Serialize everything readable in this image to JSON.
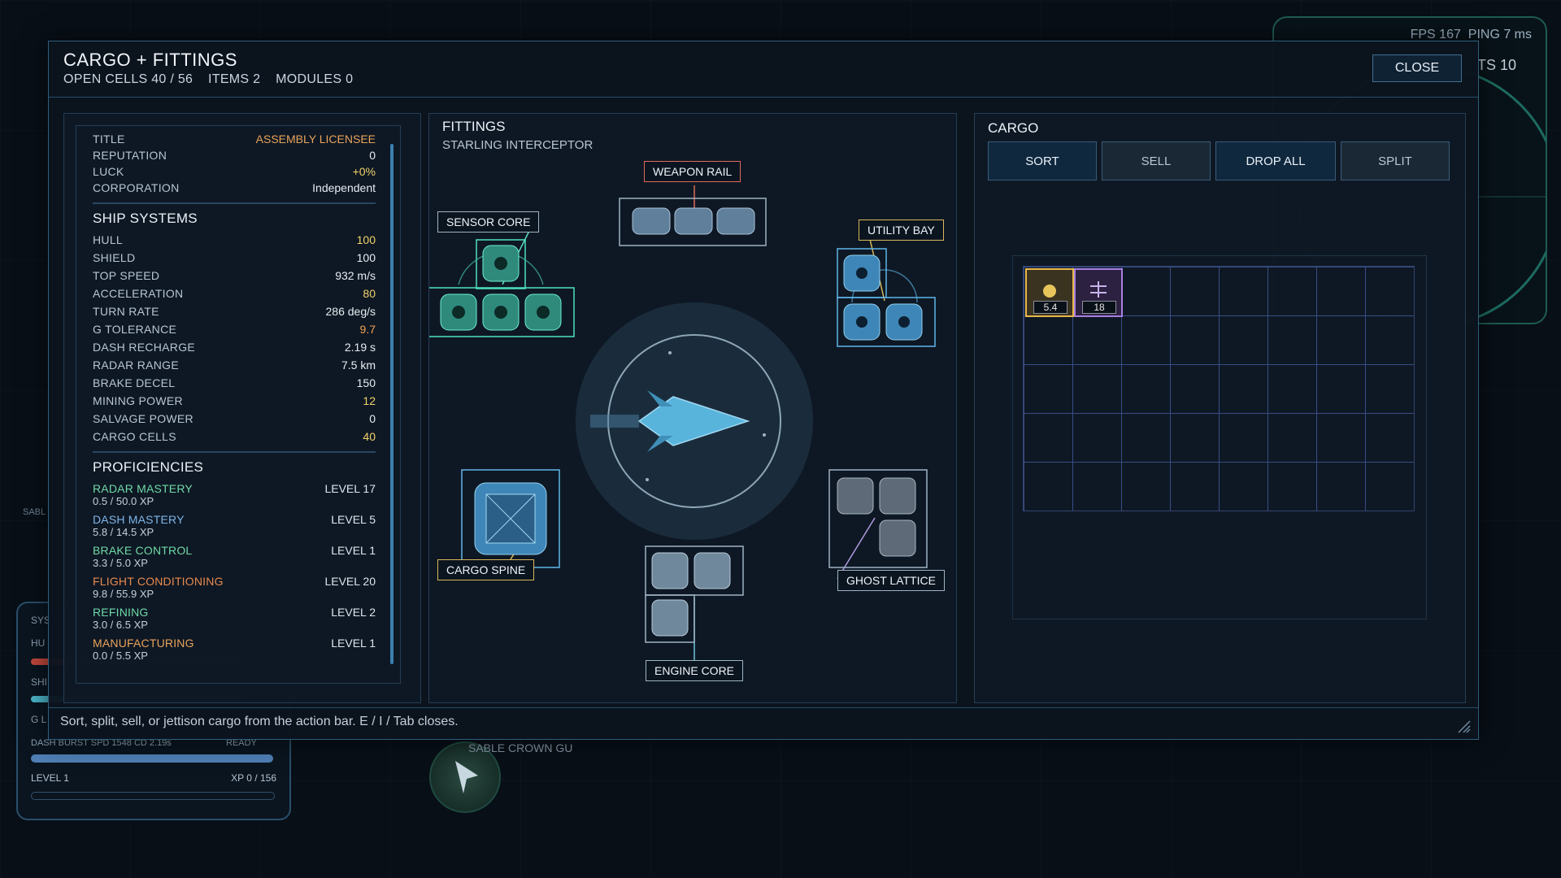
{
  "hud": {
    "fps_text": "FPS 167",
    "ping_text": "PING 7 ms",
    "side_value": "TS 10",
    "bottom_left": {
      "labels": [
        "SYS",
        "HU",
        "SHI",
        "G L"
      ],
      "dash_text": "DASH BURST  SPD 1548  CD 2.19s",
      "dash_ready": "READY",
      "level_label": "LEVEL 1",
      "xp_text": "XP 0 / 156",
      "sable": "SABL"
    },
    "nearby_name": "SABLE CROWN GU"
  },
  "panel": {
    "title": "CARGO + FITTINGS",
    "open_cells": "OPEN CELLS 40 / 56",
    "items": "ITEMS 2",
    "modules": "MODULES 0",
    "close_label": "CLOSE",
    "footer_hint": "Sort, split, sell, or jettison cargo from the action bar. E / I / Tab closes."
  },
  "profile": [
    {
      "key": "TITLE",
      "value": "ASSEMBLY LICENSEE",
      "color": "#e9a35a"
    },
    {
      "key": "REPUTATION",
      "value": "0",
      "color": "#e6edf3"
    },
    {
      "key": "LUCK",
      "value": "+0%",
      "color": "#f2d36b"
    },
    {
      "key": "CORPORATION",
      "value": "Independent",
      "color": "#e6edf3"
    }
  ],
  "ship_systems": {
    "heading": "SHIP SYSTEMS",
    "rows": [
      {
        "key": "HULL",
        "value": "100",
        "color": "#f2d36b"
      },
      {
        "key": "SHIELD",
        "value": "100",
        "color": "#e6edf3"
      },
      {
        "key": "TOP SPEED",
        "value": "932 m/s",
        "color": "#e6edf3"
      },
      {
        "key": "ACCELERATION",
        "value": "80",
        "color": "#f2d36b"
      },
      {
        "key": "TURN RATE",
        "value": "286 deg/s",
        "color": "#e6edf3"
      },
      {
        "key": "G TOLERANCE",
        "value": "9.7",
        "color": "#f0a050"
      },
      {
        "key": "DASH RECHARGE",
        "value": "2.19 s",
        "color": "#e6edf3"
      },
      {
        "key": "RADAR RANGE",
        "value": "7.5 km",
        "color": "#e6edf3"
      },
      {
        "key": "BRAKE DECEL",
        "value": "150",
        "color": "#e6edf3"
      },
      {
        "key": "MINING POWER",
        "value": "12",
        "color": "#f2d36b"
      },
      {
        "key": "SALVAGE POWER",
        "value": "0",
        "color": "#e6edf3"
      },
      {
        "key": "CARGO CELLS",
        "value": "40",
        "color": "#f2d36b"
      }
    ]
  },
  "proficiencies": {
    "heading": "PROFICIENCIES",
    "items": [
      {
        "name": "RADAR MASTERY",
        "level": "LEVEL 17",
        "xp": "0.5 / 50.0 XP",
        "color": "#6fd8a6"
      },
      {
        "name": "DASH MASTERY",
        "level": "LEVEL 5",
        "xp": "5.8 / 14.5 XP",
        "color": "#7fb6ea"
      },
      {
        "name": "BRAKE CONTROL",
        "level": "LEVEL 1",
        "xp": "3.3 / 5.0 XP",
        "color": "#6fd8a6"
      },
      {
        "name": "FLIGHT CONDITIONING",
        "level": "LEVEL 20",
        "xp": "9.8 / 55.9 XP",
        "color": "#e98a4e"
      },
      {
        "name": "REFINING",
        "level": "LEVEL 2",
        "xp": "3.0 / 6.5 XP",
        "color": "#6fd8a6"
      },
      {
        "name": "MANUFACTURING",
        "level": "LEVEL 1",
        "xp": "0.0 / 5.5 XP",
        "color": "#e9a35a"
      }
    ]
  },
  "fittings": {
    "heading": "FITTINGS",
    "ship_name": "STARLING INTERCEPTOR",
    "slots": {
      "weapon_rail": "WEAPON RAIL",
      "sensor_core": "SENSOR CORE",
      "utility_bay": "UTILITY BAY",
      "cargo_spine": "CARGO SPINE",
      "engine_core": "ENGINE CORE",
      "ghost_lattice": "GHOST LATTICE"
    }
  },
  "cargo": {
    "heading": "CARGO",
    "buttons": {
      "sort": "SORT",
      "sell": "SELL",
      "drop_all": "DROP ALL",
      "split": "SPLIT"
    },
    "items": [
      {
        "icon": "ore-icon",
        "qty": "5.4",
        "color": "#e8b84a"
      },
      {
        "icon": "component-icon",
        "qty": "18",
        "color": "#a77ee0"
      }
    ],
    "grid_cols": 8,
    "grid_rows": 5
  }
}
